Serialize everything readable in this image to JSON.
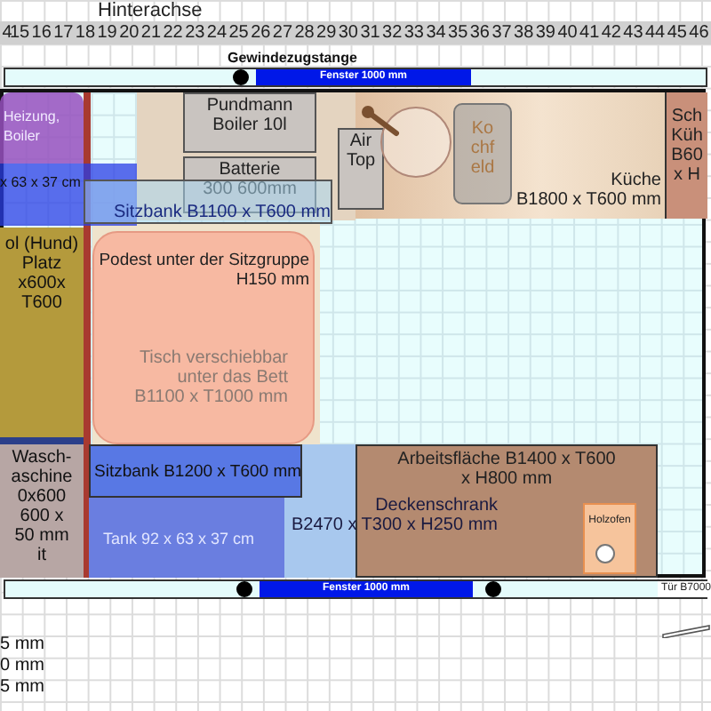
{
  "ruler": {
    "title": "Hinterachse",
    "ticks": [
      "4",
      "15",
      "16",
      "17",
      "18",
      "19",
      "20",
      "21",
      "22",
      "23",
      "24",
      "25",
      "26",
      "27",
      "28",
      "29",
      "30",
      "31",
      "32",
      "33",
      "34",
      "35",
      "36",
      "37",
      "38",
      "39",
      "40",
      "41",
      "42",
      "43",
      "44",
      "45",
      "46"
    ]
  },
  "top_wall": {
    "label": "Gewindezugstange",
    "window": "Fenster 1000 mm"
  },
  "furniture": [
    {
      "kind": "faded",
      "lines": [
        "Heizung,",
        "Boiler"
      ]
    },
    {
      "kind": "tank",
      "lines": [
        "x 63 x 37 cm"
      ]
    },
    {
      "kind": "box",
      "lines": [
        "Pundmann",
        "Boiler 10l"
      ]
    },
    {
      "kind": "box",
      "lines": [
        "Batterie",
        "300 600mm"
      ]
    },
    {
      "kind": "bench",
      "lines": [
        "Sitzbank B1100 x T600 mm"
      ]
    },
    {
      "kind": "box",
      "lines": [
        "Air",
        "Top"
      ]
    },
    {
      "kind": "kitchen",
      "lines": [
        "Küche",
        "B1800 x T600 mm"
      ]
    },
    {
      "kind": "hob",
      "lines": [
        "Ko",
        "chf",
        "eld"
      ]
    },
    {
      "kind": "cabinet",
      "lines": [
        "Sch",
        "Küh",
        "B60",
        "x H"
      ]
    },
    {
      "kind": "olive",
      "lines": [
        "ol (Hund)",
        "Platz",
        "x600x",
        "T600"
      ]
    },
    {
      "kind": "podest",
      "lines": [
        "Podest unter der Sitzgruppe",
        "H150 mm"
      ]
    },
    {
      "kind": "note",
      "lines": [
        "Tisch verschiebbar",
        "unter das Bett",
        "B1100 x T1000 mm"
      ]
    },
    {
      "kind": "washer",
      "lines": [
        "Wasch-",
        "aschine",
        "0x600",
        "600 x",
        "50 mm",
        "it"
      ]
    },
    {
      "kind": "bench2",
      "lines": [
        "Sitzbank B1200 x T600 mm"
      ]
    },
    {
      "kind": "tank2",
      "lines": [
        "Tank 92 x 63 x 37 cm"
      ]
    },
    {
      "kind": "counter",
      "lines": [
        "Arbeitsfläche B1400 x T600",
        "x H800 mm"
      ]
    },
    {
      "kind": "label",
      "lines": [
        "Deckenschrank",
        "B2470 x T300 x H250 mm"
      ]
    },
    {
      "kind": "stove",
      "lines": [
        "Holzofen"
      ]
    }
  ],
  "bottom_wall": {
    "window": "Fenster 1000 mm",
    "door": "Tür B7000"
  },
  "legend": [
    "5 mm",
    "0 mm",
    "5 mm"
  ]
}
